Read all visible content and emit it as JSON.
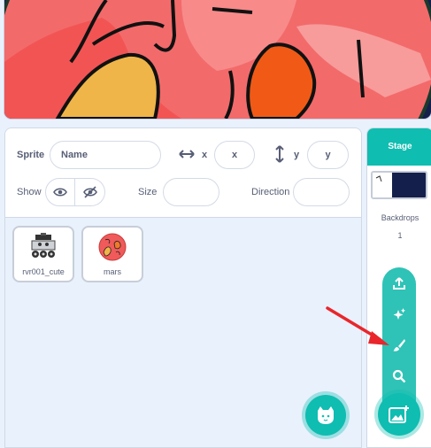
{
  "sprite_info": {
    "sprite_label": "Sprite",
    "name_placeholder": "Name",
    "x_label": "x",
    "x_placeholder": "x",
    "y_label": "y",
    "y_placeholder": "y",
    "show_label": "Show",
    "size_label": "Size",
    "size_value": "",
    "direction_label": "Direction",
    "direction_value": ""
  },
  "sprites": [
    {
      "name": "rvr001_cute",
      "icon": "rover-icon"
    },
    {
      "name": "mars",
      "icon": "mars-planet-icon"
    }
  ],
  "stage": {
    "title": "Stage",
    "backdrops_label": "Backdrops",
    "backdrops_count": "1"
  },
  "backdrop_menu": [
    "upload-icon",
    "surprise-icon",
    "paint-icon",
    "search-icon"
  ],
  "colors": {
    "accent": "#0fbdb1",
    "menu": "#2ec3b6",
    "annotation_arrow": "#e8262c",
    "stage_background": "#151f4b",
    "planet": "#f46c6c"
  }
}
